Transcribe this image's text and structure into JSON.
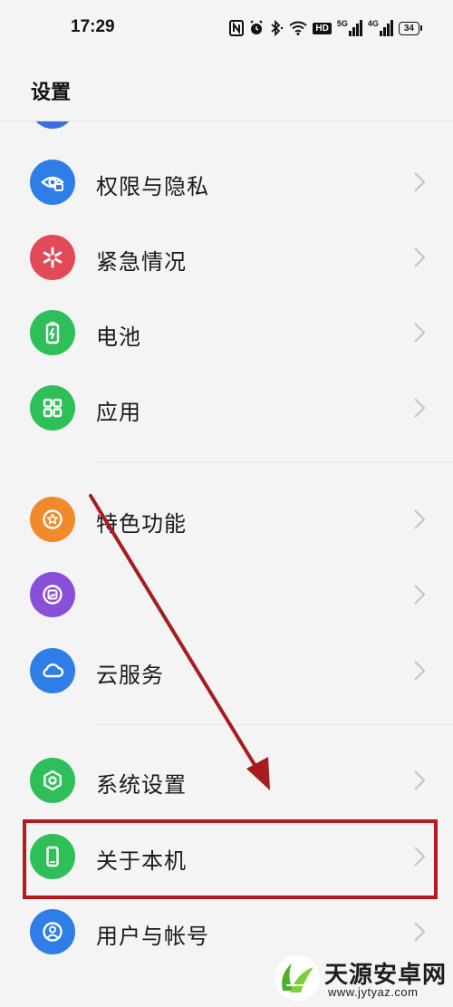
{
  "status_bar": {
    "time": "17:29",
    "icons": [
      "nfc-icon",
      "alarm-icon",
      "bluetooth-icon",
      "wifi-icon",
      "hd-icon",
      "signal-5g-icon",
      "signal-4g-icon",
      "battery-icon"
    ],
    "network_1": "5G",
    "network_2": "4G",
    "hd": "HD",
    "battery_level": "34"
  },
  "header": {
    "title": "设置"
  },
  "settings": {
    "items": [
      {
        "label": "权限与隐私",
        "icon": "privacy-eye-icon",
        "color": "#2f7ee8"
      },
      {
        "label": "紧急情况",
        "icon": "emergency-asterisk-icon",
        "color": "#e24a5a"
      },
      {
        "label": "电池",
        "icon": "battery-icon",
        "color": "#2fbf58"
      },
      {
        "label": "应用",
        "icon": "apps-grid-icon",
        "color": "#2fbf58"
      },
      {
        "label": "特色功能",
        "icon": "star-feature-icon",
        "color": "#f08a2c"
      },
      {
        "label": "",
        "icon": "wellbeing-icon",
        "color": "#8a4fd8"
      },
      {
        "label": "云服务",
        "icon": "cloud-icon",
        "color": "#2f7ee8"
      },
      {
        "label": "系统设置",
        "icon": "hexagon-settings-icon",
        "color": "#2fbf58"
      },
      {
        "label": "关于本机",
        "icon": "phone-device-icon",
        "color": "#2fbf58"
      },
      {
        "label": "用户与帐号",
        "icon": "user-account-icon",
        "color": "#2f7ee8"
      }
    ]
  },
  "annotation": {
    "color": "#b5191c"
  },
  "watermark": {
    "title": "天源安卓网",
    "url": "www.jytyaz.com"
  }
}
